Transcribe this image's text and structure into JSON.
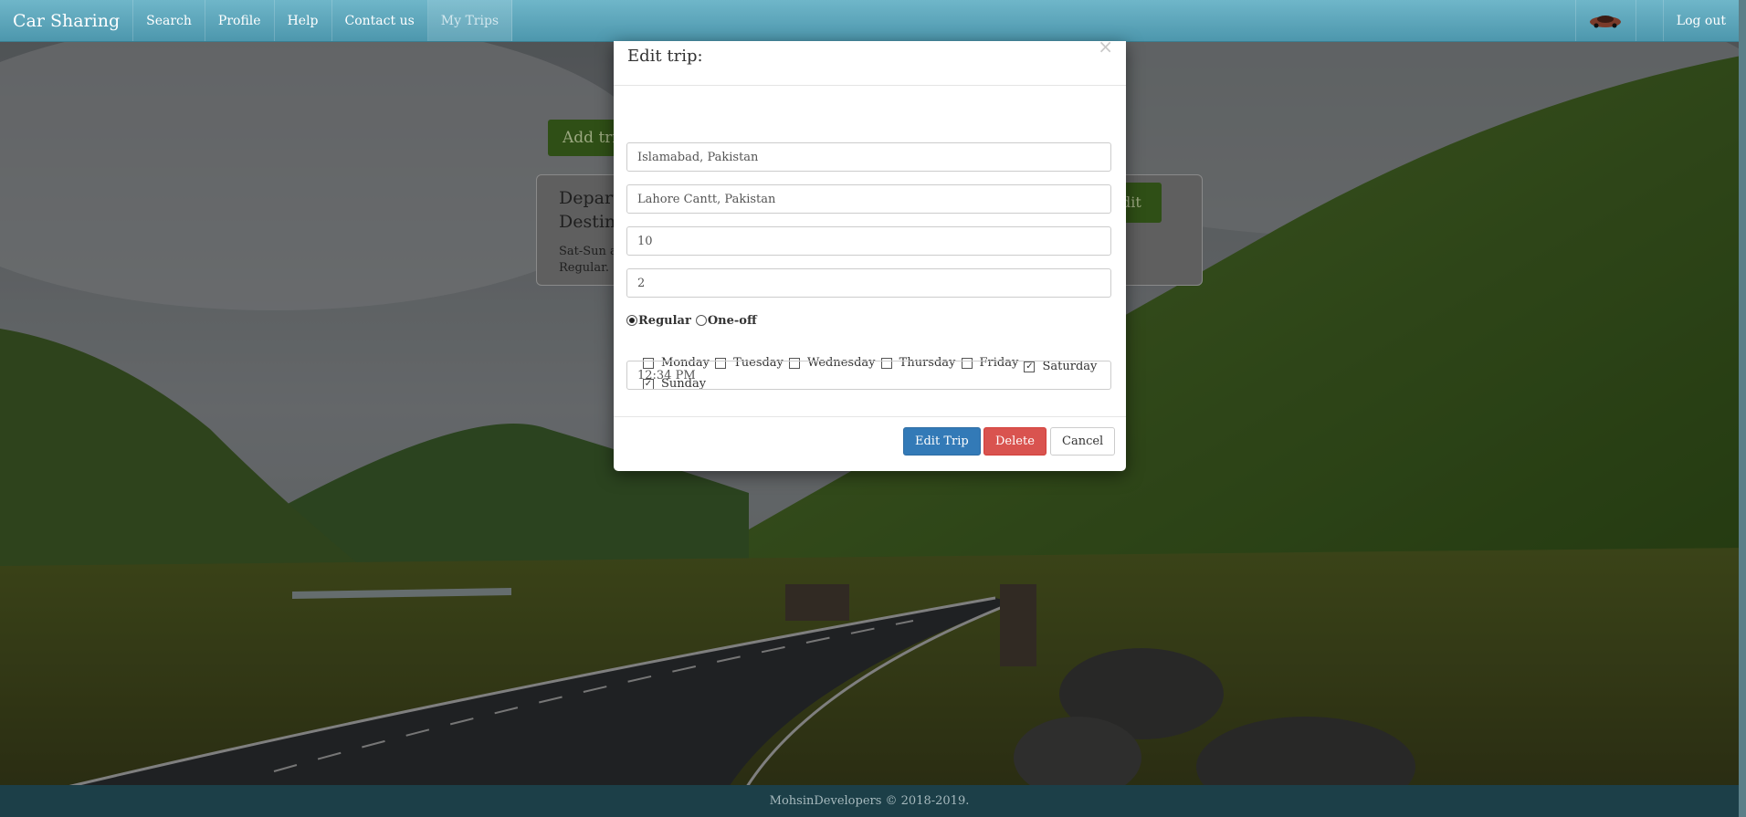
{
  "navbar": {
    "brand": "Car Sharing",
    "items": [
      "Search",
      "Profile",
      "Help",
      "Contact us",
      "My Trips"
    ],
    "active": "My Trips",
    "logout": "Log out"
  },
  "page": {
    "add_trip_label": "Add trip",
    "trip_card": {
      "departure_label": "Depart",
      "destination_label": "Destin",
      "schedule": "Sat-Sun a",
      "type": "Regular.",
      "edit_label": "dit"
    }
  },
  "modal": {
    "title": "Edit trip:",
    "close": "×",
    "departure": "Islamabad, Pakistan",
    "destination": "Lahore Cantt, Pakistan",
    "price": "10",
    "seats": "2",
    "trip_type": {
      "options": [
        "Regular",
        "One-off"
      ],
      "selected": "Regular"
    },
    "days": [
      {
        "label": "Monday",
        "checked": false
      },
      {
        "label": "Tuesday",
        "checked": false
      },
      {
        "label": "Wednesday",
        "checked": false
      },
      {
        "label": "Thursday",
        "checked": false
      },
      {
        "label": "Friday",
        "checked": false
      },
      {
        "label": "Saturday",
        "checked": true
      },
      {
        "label": "Sunday",
        "checked": true
      }
    ],
    "time": "12:34 PM",
    "buttons": {
      "edit": "Edit Trip",
      "delete": "Delete",
      "cancel": "Cancel"
    }
  },
  "footer": {
    "text": "MohsinDevelopers © 2018-2019."
  },
  "colors": {
    "navbar": "#5fa9bd",
    "primary": "#337ab7",
    "danger": "#d9534f",
    "success": "#2f4f16",
    "footer": "#1c3f48"
  }
}
